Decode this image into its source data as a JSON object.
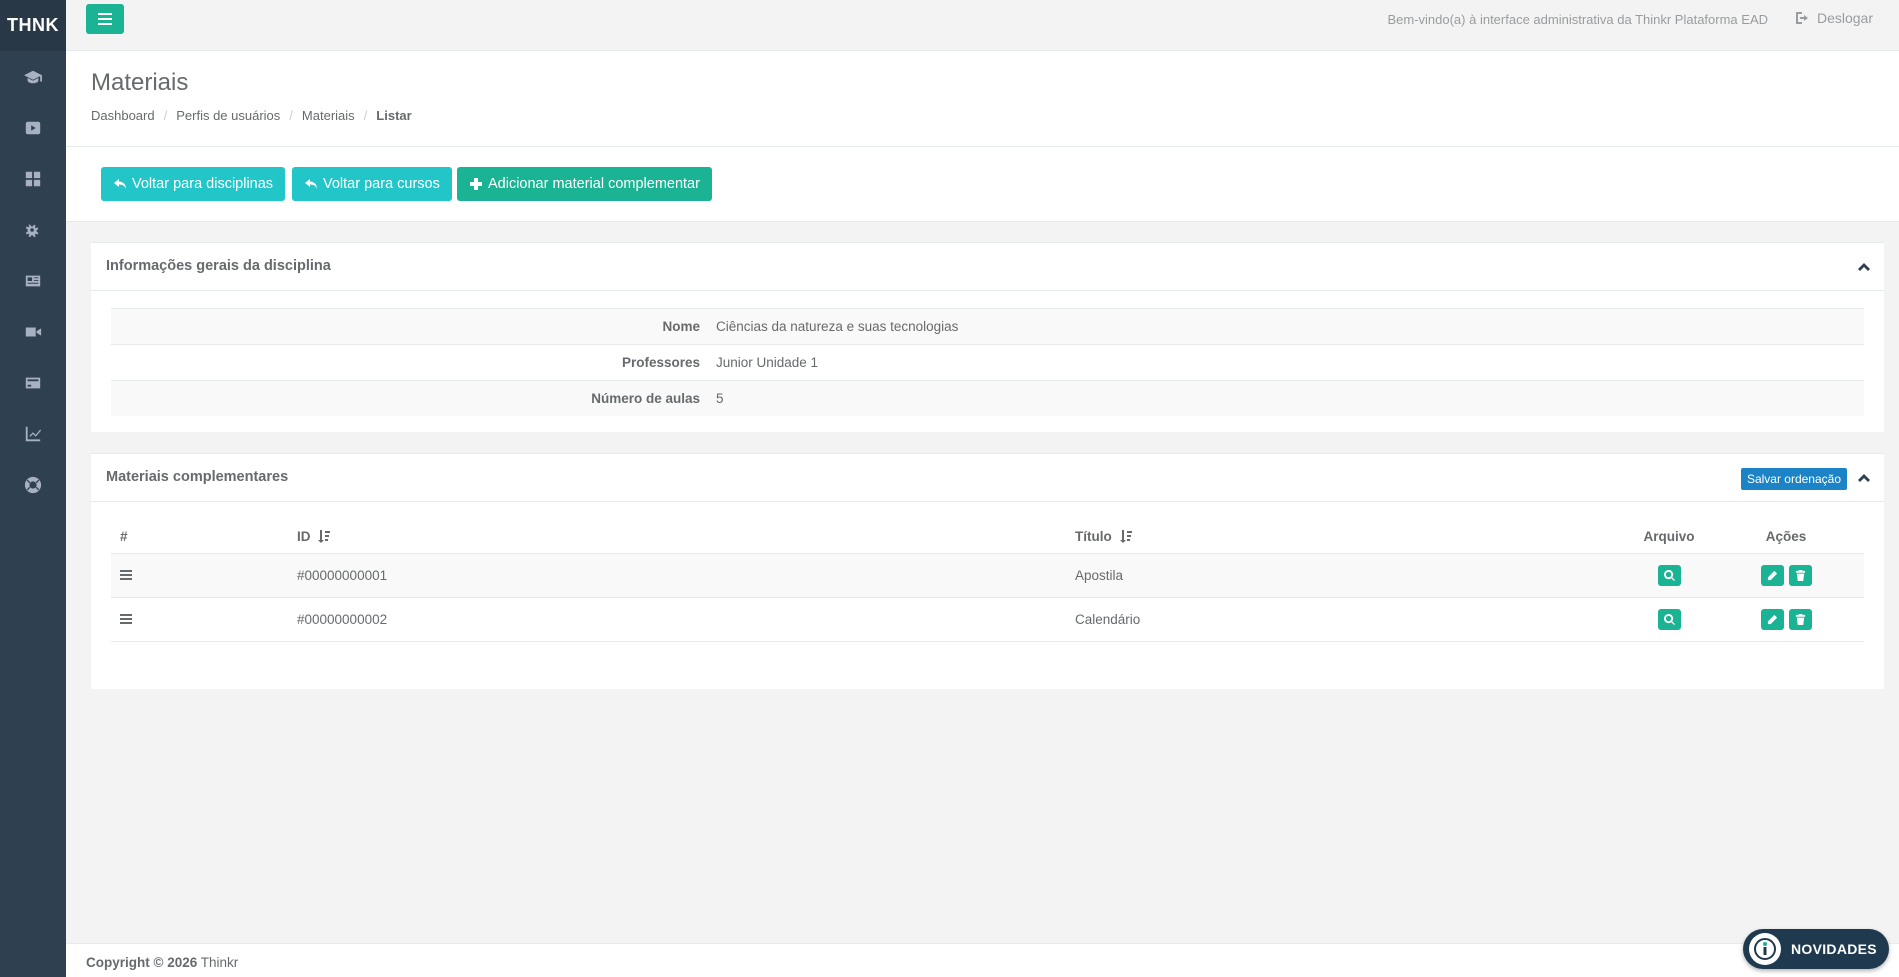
{
  "sidebar": {
    "logo": "THNK",
    "items": [
      {
        "icon": "graduation-cap-icon"
      },
      {
        "icon": "youtube-play-icon"
      },
      {
        "icon": "dashboard-grid-icon"
      },
      {
        "icon": "gears-icon"
      },
      {
        "icon": "newspaper-icon"
      },
      {
        "icon": "video-camera-icon"
      },
      {
        "icon": "credit-card-icon"
      },
      {
        "icon": "line-chart-icon"
      },
      {
        "icon": "life-ring-icon"
      }
    ]
  },
  "topbar": {
    "welcome": "Bem-vindo(a) à interface administrativa da Thinkr Plataforma EAD",
    "logout": "Deslogar"
  },
  "heading": {
    "title": "Materiais",
    "breadcrumb": [
      "Dashboard",
      "Perfis de usuários",
      "Materiais",
      "Listar"
    ]
  },
  "toolbar": {
    "back_disciplines": "Voltar para disciplinas",
    "back_courses": "Voltar para cursos",
    "add_material": "Adicionar material complementar"
  },
  "info_panel": {
    "title": "Informações gerais da disciplina",
    "rows": [
      {
        "label": "Nome",
        "value": "Ciências da natureza e suas tecnologias"
      },
      {
        "label": "Professores",
        "value": "Junior Unidade 1"
      },
      {
        "label": "Número de aulas",
        "value": "5"
      }
    ]
  },
  "materials_panel": {
    "title": "Materiais complementares",
    "save_order": "Salvar ordenação",
    "headers": {
      "hash": "#",
      "id": "ID",
      "title": "Título",
      "file": "Arquivo",
      "actions": "Ações"
    },
    "rows": [
      {
        "id": "#00000000001",
        "title": "Apostila"
      },
      {
        "id": "#00000000002",
        "title": "Calendário"
      }
    ]
  },
  "footer": {
    "copyright": "Copyright © 2026",
    "brand": "Thinkr"
  },
  "novidades": "NOVIDADES",
  "colors": {
    "sidebar": "#2f4050",
    "primary": "#1ab394",
    "info": "#23c6c8",
    "blue": "#1c84c6"
  }
}
